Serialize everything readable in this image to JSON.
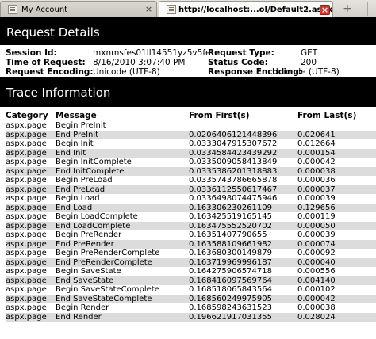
{
  "browser": {
    "tabs": [
      {
        "label": "My Account",
        "active": false
      },
      {
        "label": "http://localhost:...ol/Default2.aspx",
        "active": true
      }
    ],
    "new_tab": "+",
    "close_glyph": "×",
    "favicon": "page-icon"
  },
  "request": {
    "header": "Request Details",
    "session_id_label": "Session Id:",
    "session_id": "mxnmsfes01ll14551yz5v5fe",
    "request_type_label": "Request Type:",
    "request_type": "GET",
    "time_label": "Time of Request:",
    "time": "8/16/2010 3:07:40 PM",
    "status_code_label": "Status Code:",
    "status_code": "200",
    "request_encoding_label": "Request Encoding:",
    "request_encoding": "Unicode (UTF-8)",
    "response_encoding_label": "Response Encoding:",
    "response_encoding": "Unicode (UTF-8)"
  },
  "trace": {
    "header": "Trace Information",
    "columns": [
      "Category",
      "Message",
      "From First(s)",
      "From Last(s)"
    ],
    "rows": [
      [
        "aspx.page",
        "Begin PreInit",
        "",
        ""
      ],
      [
        "aspx.page",
        "End PreInit",
        "0.0206406121448396",
        "0.020641"
      ],
      [
        "aspx.page",
        "Begin Init",
        "0.0333047915307672",
        "0.012664"
      ],
      [
        "aspx.page",
        "End Init",
        "0.0334584423439292",
        "0.000154"
      ],
      [
        "aspx.page",
        "Begin InitComplete",
        "0.0335009058413849",
        "0.000042"
      ],
      [
        "aspx.page",
        "End InitComplete",
        "0.0335386201318883",
        "0.000038"
      ],
      [
        "aspx.page",
        "Begin PreLoad",
        "0.0335743786665878",
        "0.000036"
      ],
      [
        "aspx.page",
        "End PreLoad",
        "0.0336112550617467",
        "0.000037"
      ],
      [
        "aspx.page",
        "Begin Load",
        "0.0336498074475946",
        "0.000039"
      ],
      [
        "aspx.page",
        "End Load",
        "0.163306230261109",
        "0.129656"
      ],
      [
        "aspx.page",
        "Begin LoadComplete",
        "0.163425519165145",
        "0.000119"
      ],
      [
        "aspx.page",
        "End LoadComplete",
        "0.163475552520702",
        "0.000050"
      ],
      [
        "aspx.page",
        "Begin PreRender",
        "0.16351407790655",
        "0.000039"
      ],
      [
        "aspx.page",
        "End PreRender",
        "0.163588109661982",
        "0.000074"
      ],
      [
        "aspx.page",
        "Begin PreRenderComplete",
        "0.163680300149879",
        "0.000092"
      ],
      [
        "aspx.page",
        "End PreRenderComplete",
        "0.163719969996187",
        "0.000040"
      ],
      [
        "aspx.page",
        "Begin SaveState",
        "0.164275906574718",
        "0.000556"
      ],
      [
        "aspx.page",
        "End SaveState",
        "0.168416097569764",
        "0.004140"
      ],
      [
        "aspx.page",
        "Begin SaveStateComplete",
        "0.168518065843564",
        "0.000102"
      ],
      [
        "aspx.page",
        "End SaveStateComplete",
        "0.168560249975905",
        "0.000042"
      ],
      [
        "aspx.page",
        "Begin Render",
        "0.168598243631523",
        "0.000038"
      ],
      [
        "aspx.page",
        "End Render",
        "0.196621917031355",
        "0.028024"
      ]
    ]
  },
  "colors": {
    "header_bg": "#000000",
    "header_text": "#ffffff",
    "alt_row": "#dcdcdc",
    "close_button": "#d7352b"
  }
}
